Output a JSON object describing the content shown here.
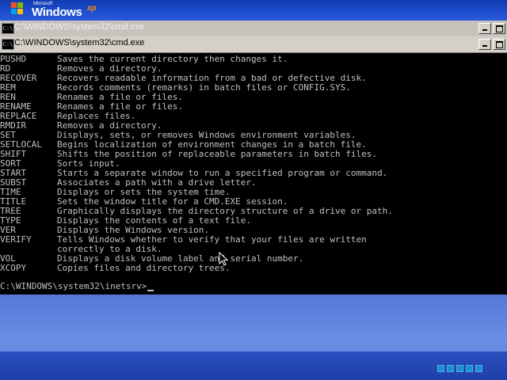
{
  "brand": {
    "microsoft": "Microsoft",
    "windows": "Windows",
    "xp": "xp"
  },
  "background_window": {
    "title": "C:\\WINDOWS\\system32\\cmd.exe",
    "icon_text": "C:\\"
  },
  "cmd_window": {
    "title": "C:\\WINDOWS\\system32\\cmd.exe",
    "icon_text": "C:\\",
    "lines": [
      {
        "cmd": "PUSHD",
        "desc": "Saves the current directory then changes it."
      },
      {
        "cmd": "RD",
        "desc": "Removes a directory."
      },
      {
        "cmd": "RECOVER",
        "desc": "Recovers readable information from a bad or defective disk."
      },
      {
        "cmd": "REM",
        "desc": "Records comments (remarks) in batch files or CONFIG.SYS."
      },
      {
        "cmd": "REN",
        "desc": "Renames a file or files."
      },
      {
        "cmd": "RENAME",
        "desc": "Renames a file or files."
      },
      {
        "cmd": "REPLACE",
        "desc": "Replaces files."
      },
      {
        "cmd": "RMDIR",
        "desc": "Removes a directory."
      },
      {
        "cmd": "SET",
        "desc": "Displays, sets, or removes Windows environment variables."
      },
      {
        "cmd": "SETLOCAL",
        "desc": "Begins localization of environment changes in a batch file."
      },
      {
        "cmd": "SHIFT",
        "desc": "Shifts the position of replaceable parameters in batch files."
      },
      {
        "cmd": "SORT",
        "desc": "Sorts input."
      },
      {
        "cmd": "START",
        "desc": "Starts a separate window to run a specified program or command."
      },
      {
        "cmd": "SUBST",
        "desc": "Associates a path with a drive letter."
      },
      {
        "cmd": "TIME",
        "desc": "Displays or sets the system time."
      },
      {
        "cmd": "TITLE",
        "desc": "Sets the window title for a CMD.EXE session."
      },
      {
        "cmd": "TREE",
        "desc": "Graphically displays the directory structure of a drive or path."
      },
      {
        "cmd": "TYPE",
        "desc": "Displays the contents of a text file."
      },
      {
        "cmd": "VER",
        "desc": "Displays the Windows version."
      },
      {
        "cmd": "VERIFY",
        "desc": "Tells Windows whether to verify that your files are written"
      },
      {
        "cmd": "",
        "desc": "correctly to a disk."
      },
      {
        "cmd": "VOL",
        "desc": "Displays a disk volume label and serial number."
      },
      {
        "cmd": "XCOPY",
        "desc": "Copies files and directory trees."
      }
    ],
    "prompt": "C:\\WINDOWS\\system32\\inetsrv>"
  },
  "colors": {
    "console_bg": "#000000",
    "console_text": "#c0c0c0",
    "desktop": "#5a7edc",
    "progress": "#1c8fd0"
  },
  "icons": [
    "windows-flag-icon",
    "cmd-icon",
    "minimize-icon",
    "maximize-icon",
    "mouse-pointer-icon"
  ]
}
